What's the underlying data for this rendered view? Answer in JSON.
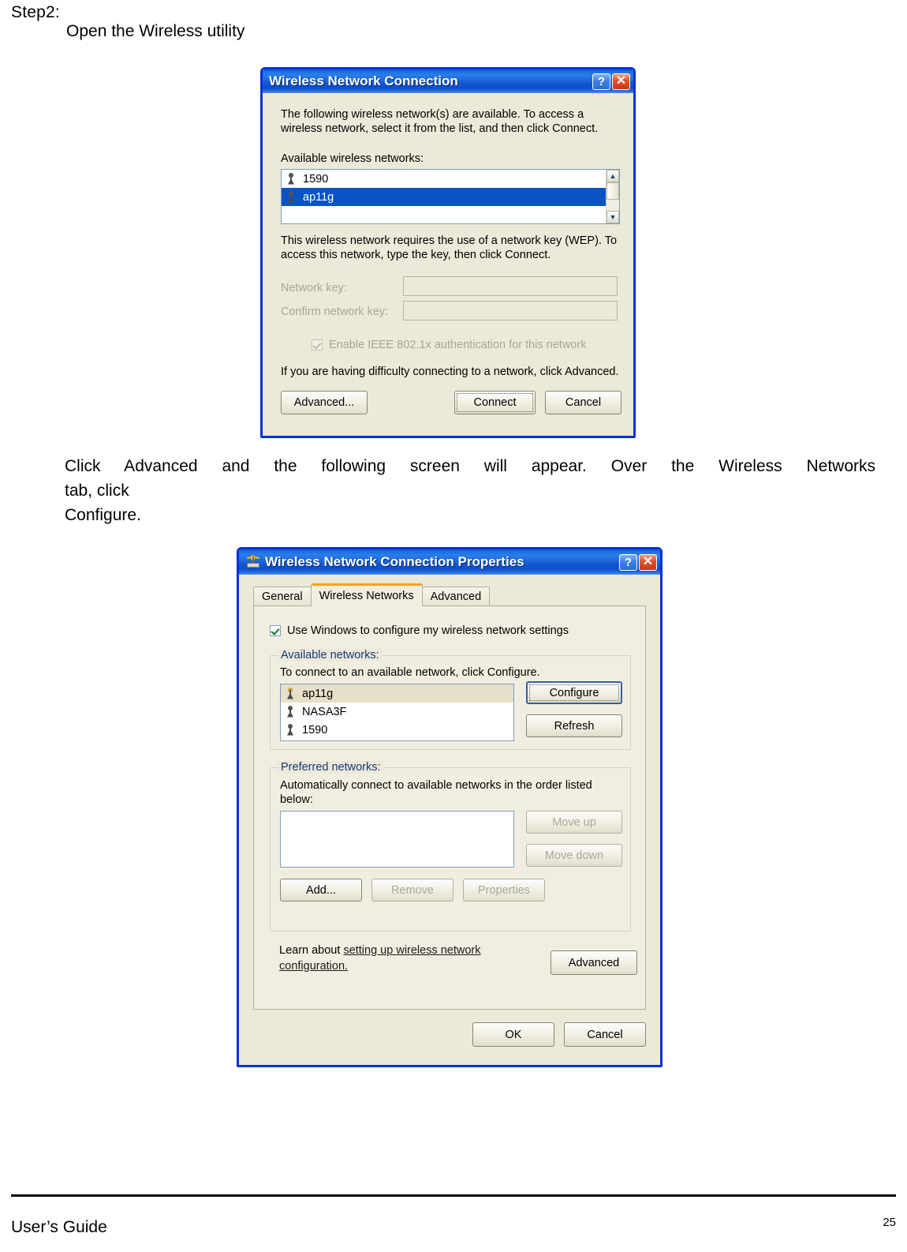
{
  "document": {
    "step_label": "Step2:",
    "step_text": "Open the Wireless utility",
    "paragraph_line1": "Click Advanced and the following screen will appear. Over the Wireless Networks",
    "paragraph_line2": "tab,  click",
    "paragraph_line3": "Configure.",
    "footer_left": "User’s Guide",
    "footer_page": "25"
  },
  "dialog1": {
    "title": "Wireless Network Connection",
    "help_button": "?",
    "close_button": "✕",
    "intro_line1": "The following wireless network(s) are available. To access a",
    "intro_line2": "wireless network, select it from the list, and then click Connect.",
    "available_label": "Available wireless networks:",
    "networks": [
      {
        "name": "1590",
        "selected": false,
        "icon": "antenna-icon"
      },
      {
        "name": "ap11g",
        "selected": true,
        "icon": "antenna-icon"
      }
    ],
    "wep_line1": "This wireless network requires the use of a network key (WEP). To",
    "wep_line2": "access this network, type the key, then click Connect.",
    "network_key_label": "Network key:",
    "network_key_value": "",
    "confirm_key_label": "Confirm network key:",
    "confirm_key_value": "",
    "ieee_checkbox_label": "Enable IEEE 802.1x authentication for this network",
    "ieee_checked": true,
    "difficulty_text": "If you are having difficulty connecting to a network, click Advanced.",
    "buttons": {
      "advanced": "Advanced...",
      "connect": "Connect",
      "cancel": "Cancel"
    },
    "scrollbar": {
      "up": "▲",
      "down": "▼"
    }
  },
  "dialog2": {
    "title": "Wireless Network Connection Properties",
    "help_button": "?",
    "close_button": "✕",
    "tabs": [
      {
        "label": "General",
        "active": false
      },
      {
        "label": "Wireless Networks",
        "active": true
      },
      {
        "label": "Advanced",
        "active": false
      }
    ],
    "use_windows_checkbox": "Use Windows to configure my wireless network settings",
    "use_windows_checked": true,
    "available_group": {
      "title": "Available networks:",
      "hint": "To connect to an available network, click Configure.",
      "networks": [
        {
          "name": "ap11g",
          "selected": true,
          "icon": "antenna-active-icon"
        },
        {
          "name": "NASA3F",
          "selected": false,
          "icon": "antenna-icon"
        },
        {
          "name": "1590",
          "selected": false,
          "icon": "antenna-icon"
        }
      ],
      "configure_button": "Configure",
      "refresh_button": "Refresh"
    },
    "preferred_group": {
      "title": "Preferred networks:",
      "hint_line1": "Automatically connect to available networks in the order listed",
      "hint_line2": "below:",
      "networks": [],
      "move_up_button": "Move up",
      "move_down_button": "Move down",
      "add_button": "Add...",
      "remove_button": "Remove",
      "properties_button": "Properties"
    },
    "learn_prefix": "Learn about ",
    "learn_link_line1": "setting up wireless network",
    "learn_link_line2": "configuration.",
    "advanced_button": "Advanced",
    "ok_button": "OK",
    "cancel_button": "Cancel"
  },
  "colors": {
    "titlebar_blue": "#0a59d6",
    "dialog_face": "#ece9d8",
    "selection_blue": "#0a53c4",
    "selection_beige": "#e6e0c8",
    "tab_active_accent": "#f7a31c",
    "group_label_blue": "#16387c"
  }
}
